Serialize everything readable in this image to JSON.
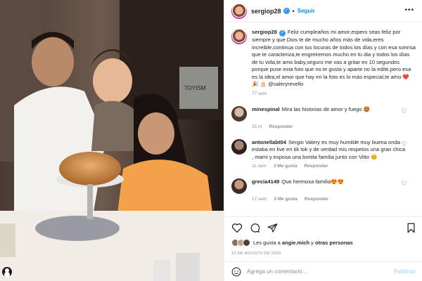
{
  "post": {
    "username": "sergiop28",
    "follow_label": "Seguir",
    "more_label": "•••",
    "verified_mark": "✓",
    "dot": "•"
  },
  "caption": {
    "username": "sergiop28",
    "text": "Feliz cumpleaños mi amor,espero seas feliz por siempre y que Dios te de mucho años más de vida,eres increible,continua con tus locuras de todos los días y con esa sonrisa que te caracteriza,te engreiremos mucho en tu dia y todos los días de tu vida,te amo baby,seguro me vas a gritar en 10 segundos porque puse esta foto que no te gusta y aparte no la edite,pero esa es la idea,el amor que hay en la foto es lo más especial,te amo ❤️ 🎉 🎂 @valeryrevello",
    "time": "77 sem"
  },
  "comments": [
    {
      "username": "minespinal",
      "text": "Mira las historias de amor y fuego 🥵",
      "time": "15 m",
      "likes": "",
      "reply_label": "Responder"
    },
    {
      "username": "antonellabt04",
      "text": "Sergio Valery es muy humilde muy buena onda estaba en live en tik tok y de verdad mis respetos una gran chica , mami y esposa una bonita familia junto con Vitto 😊",
      "time": "11 sem",
      "likes": "3 Me gusta",
      "reply_label": "Responder"
    },
    {
      "username": "grecia4149",
      "text": "Que hermosa familia😍😍",
      "time": "17 sem",
      "likes": "3 Me gusta",
      "reply_label": "Responder"
    }
  ],
  "actions": {
    "liked_by_prefix": "Les gusta a",
    "liked_by_user": "angie.mich",
    "liked_by_suffix": "y",
    "liked_by_others": "otras personas",
    "date": "10 DE AGOSTO DE 2020"
  },
  "composer": {
    "placeholder": "Agrega un comentario...",
    "publish_label": "Publicar"
  },
  "colors": {
    "link_blue": "#0095f6",
    "verified_blue": "#3897f0",
    "muted_gray": "#8e8e8e",
    "divider": "#efefef",
    "publish_disabled": "#b2dffc"
  },
  "icons": [
    "heart-icon",
    "comment-icon",
    "share-icon",
    "bookmark-icon",
    "emoji-icon",
    "more-icon",
    "verified-icon",
    "user-tag-icon"
  ]
}
